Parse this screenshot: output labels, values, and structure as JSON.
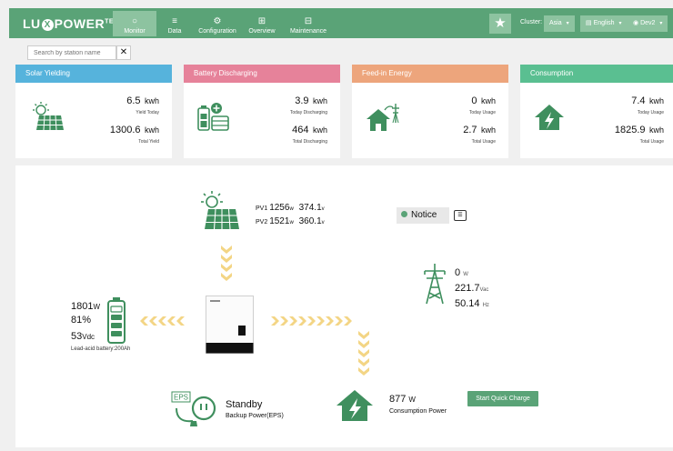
{
  "brand": {
    "left": "LU",
    "x": "X",
    "right": "POWER",
    "tm": "TEK"
  },
  "nav": [
    {
      "label": "Monitor",
      "icon": "○"
    },
    {
      "label": "Data",
      "icon": "≡"
    },
    {
      "label": "Configuration",
      "icon": "⚙"
    },
    {
      "label": "Overview",
      "icon": "⊞"
    },
    {
      "label": "Maintenance",
      "icon": "⊟"
    }
  ],
  "header": {
    "star": "★",
    "cluster_label": "Cluster:",
    "cluster_value": "Asia",
    "language": "English",
    "user": "Dev2",
    "caret": "▾"
  },
  "search": {
    "placeholder": "Search by station name",
    "clear": "✕"
  },
  "cards": [
    {
      "title": "Solar Yielding",
      "v1": "6.5",
      "u1": "kwh",
      "l1": "Yield Today",
      "v2": "1300.6",
      "u2": "kwh",
      "l2": "Total Yield",
      "color": "#56b3dc"
    },
    {
      "title": "Battery Discharging",
      "v1": "3.9",
      "u1": "kwh",
      "l1": "Today Discharging",
      "v2": "464",
      "u2": "kwh",
      "l2": "Total Discharging",
      "color": "#e6829a"
    },
    {
      "title": "Feed-in Energy",
      "v1": "0",
      "u1": "kwh",
      "l1": "Today Usage",
      "v2": "2.7",
      "u2": "kwh",
      "l2": "Total Usage",
      "color": "#eda57c"
    },
    {
      "title": "Consumption",
      "v1": "7.4",
      "u1": "kwh",
      "l1": "Today Usage",
      "v2": "1825.9",
      "u2": "kwh",
      "l2": "Total Usage",
      "color": "#5abf91"
    }
  ],
  "pv": {
    "pv1_label": "PV1",
    "pv1_w": "1256",
    "pv1_v": "374.1",
    "pv2_label": "PV2",
    "pv2_w": "1521",
    "pv2_v": "360.1",
    "w_unit": "w",
    "v_unit": "v"
  },
  "notice": {
    "label": "Notice",
    "button": "☰"
  },
  "grid": {
    "power": "0",
    "power_unit": "W",
    "voltage": "221.7",
    "voltage_unit": "Vac",
    "freq": "50.14",
    "freq_unit": "Hz"
  },
  "battery": {
    "power": "1801",
    "power_unit": "W",
    "soc": "81%",
    "voltage": "53",
    "voltage_unit": "Vdc",
    "type_label": "Lead-acid battery:",
    "capacity": "200",
    "capacity_unit": "Ah"
  },
  "inverter": {
    "brand": "LUXPOWER"
  },
  "eps": {
    "badge": "EPS",
    "status": "Standby",
    "label": "Backup Power(EPS)"
  },
  "consumption": {
    "power": "877",
    "unit": "W",
    "label": "Consumption Power"
  },
  "quick_charge": "Start Quick Charge",
  "colors": {
    "accent": "#5aa377",
    "flow": "#f3d585",
    "icon_green": "#3f8f5e"
  }
}
